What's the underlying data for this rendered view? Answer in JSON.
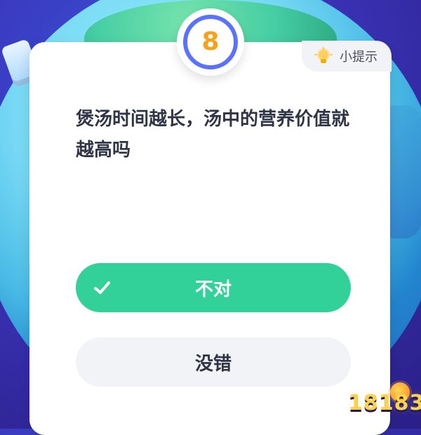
{
  "quiz": {
    "question_number": "8",
    "hint_label": "小提示",
    "question_text": "煲汤时间越长，汤中的营养价值就越高吗",
    "options": [
      {
        "label": "不对",
        "state": "selected_correct"
      },
      {
        "label": "没错",
        "state": "unselected"
      }
    ]
  },
  "icons": {
    "hint": "lightbulb-icon",
    "correct": "check-icon"
  },
  "colors": {
    "accent_ring": "#5a72ff",
    "number": "#f6a31b",
    "correct_bg": "#33d19a",
    "neutral_bg": "#f2f3f7",
    "text_dark": "#2f3446"
  },
  "watermark": {
    "text": "18183"
  }
}
